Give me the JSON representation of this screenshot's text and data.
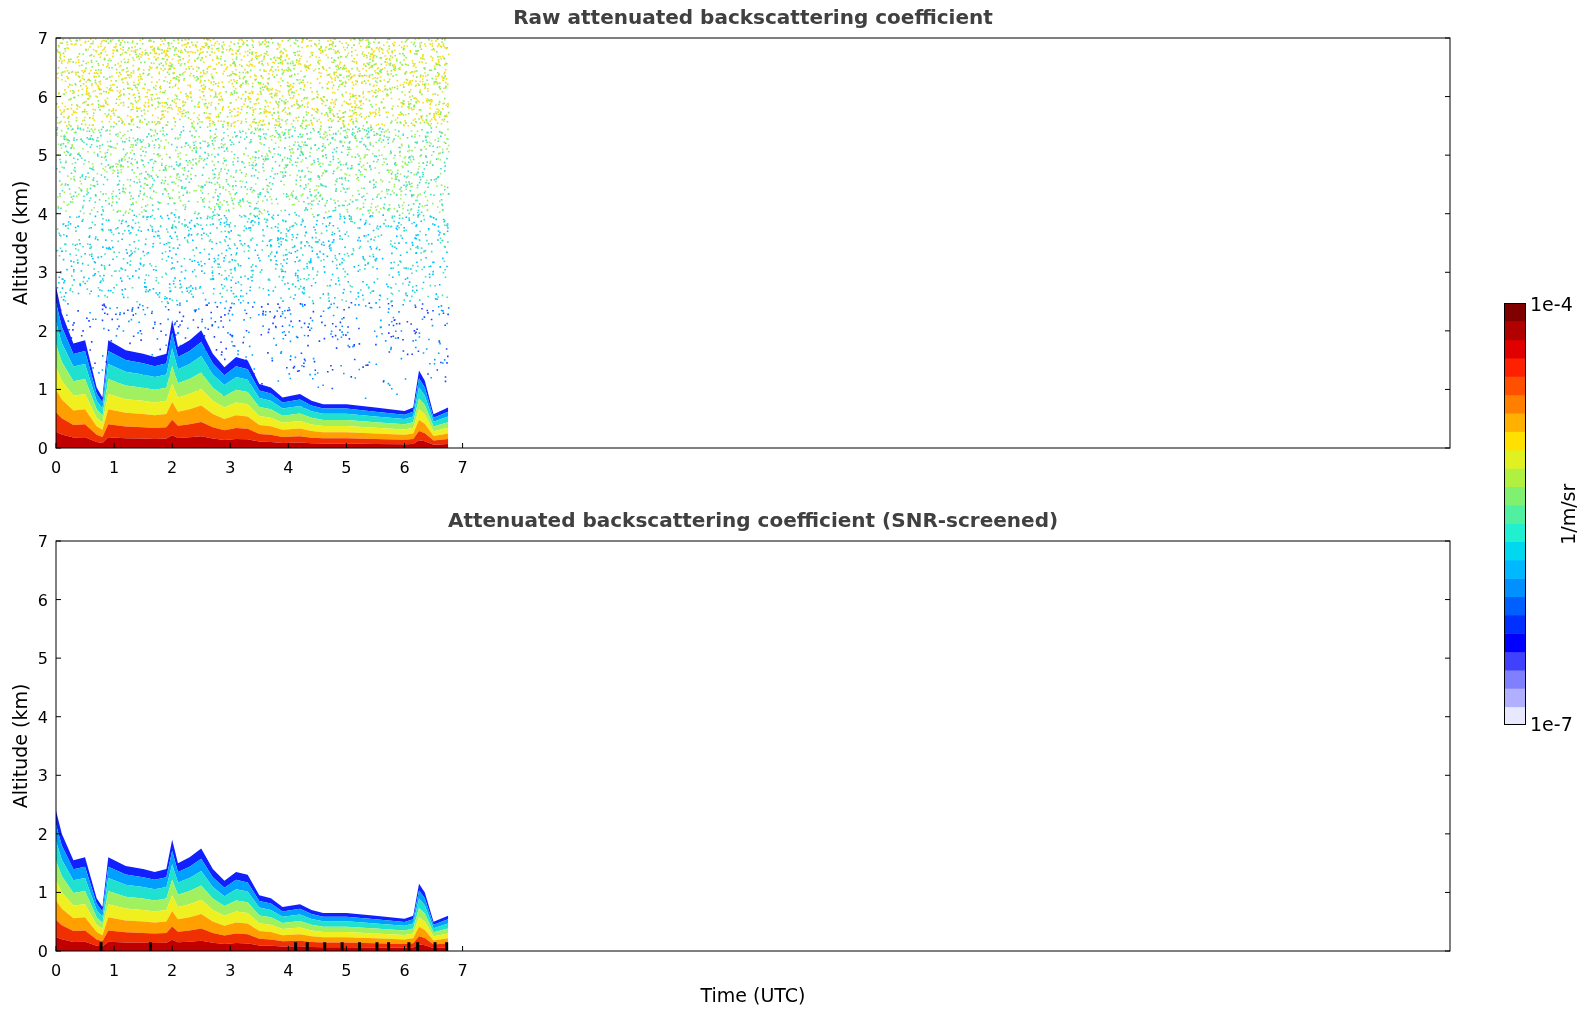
{
  "panels": [
    {
      "kind": "raw",
      "title": "Raw attenuated backscattering coefficient",
      "ylabel": "Altitude (km)",
      "y_tick_labels": [
        "7",
        "6",
        "5",
        "4",
        "3",
        "2",
        "1",
        "0"
      ],
      "x_tick_labels": [
        "0",
        "1",
        "2",
        "3",
        "4",
        "5",
        "6",
        "7"
      ]
    },
    {
      "kind": "screened",
      "title": "Attenuated backscattering coefficient (SNR-screened)",
      "ylabel": "Altitude (km)",
      "y_tick_labels": [
        "7",
        "6",
        "5",
        "4",
        "3",
        "2",
        "1",
        "0"
      ],
      "x_tick_labels": [
        "0",
        "1",
        "2",
        "3",
        "4",
        "5",
        "6",
        "7"
      ]
    }
  ],
  "xlabel": "Time (UTC)",
  "colorbar": {
    "max_label": "1e-4",
    "min_label": "1e-7",
    "label": "1/m/sr"
  }
}
